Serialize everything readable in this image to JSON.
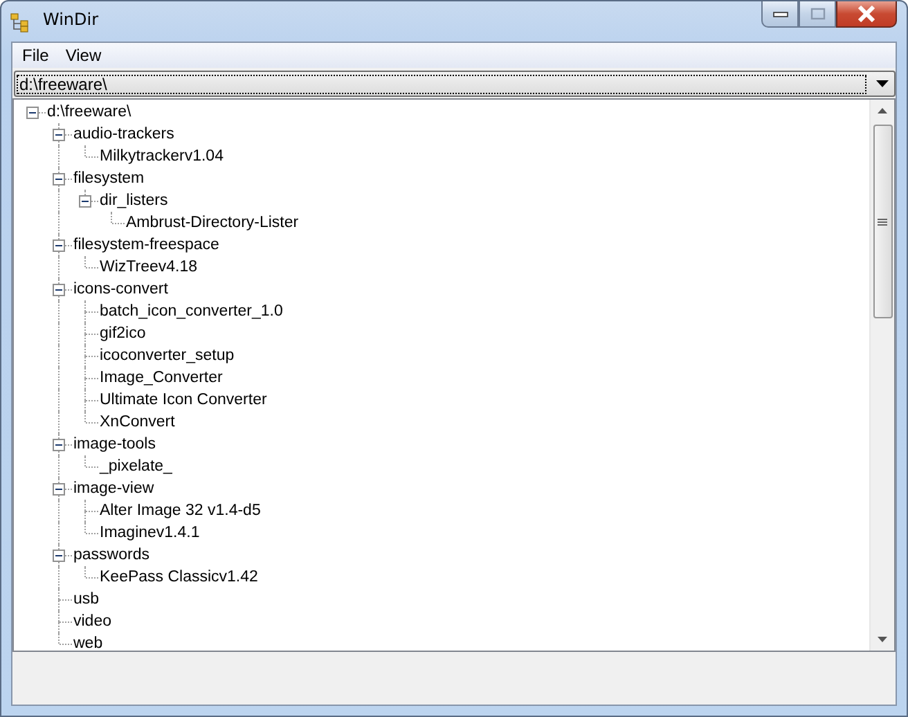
{
  "window": {
    "title": "WinDir"
  },
  "menu": [
    "File",
    "View"
  ],
  "path_combo": {
    "value": "d:\\freeware\\"
  },
  "tree": [
    {
      "label": "d:\\freeware\\",
      "expanded": true,
      "children": [
        {
          "label": "audio-trackers",
          "expanded": true,
          "children": [
            {
              "label": "Milkytrackerv1.04"
            }
          ]
        },
        {
          "label": "filesystem",
          "expanded": true,
          "children": [
            {
              "label": "dir_listers",
              "expanded": true,
              "children": [
                {
                  "label": "Ambrust-Directory-Lister"
                }
              ]
            }
          ]
        },
        {
          "label": "filesystem-freespace",
          "expanded": true,
          "children": [
            {
              "label": "WizTreev4.18"
            }
          ]
        },
        {
          "label": "icons-convert",
          "expanded": true,
          "children": [
            {
              "label": "batch_icon_converter_1.0"
            },
            {
              "label": "gif2ico"
            },
            {
              "label": "icoconverter_setup"
            },
            {
              "label": "Image_Converter"
            },
            {
              "label": "Ultimate Icon Converter"
            },
            {
              "label": "XnConvert"
            }
          ]
        },
        {
          "label": "image-tools",
          "expanded": true,
          "children": [
            {
              "label": "_pixelate_"
            }
          ]
        },
        {
          "label": "image-view",
          "expanded": true,
          "children": [
            {
              "label": "Alter Image 32 v1.4-d5"
            },
            {
              "label": "Imaginev1.4.1"
            }
          ]
        },
        {
          "label": "passwords",
          "expanded": true,
          "children": [
            {
              "label": "KeePass Classicv1.42"
            }
          ]
        },
        {
          "label": "usb"
        },
        {
          "label": "video"
        },
        {
          "label": "web"
        }
      ]
    }
  ]
}
